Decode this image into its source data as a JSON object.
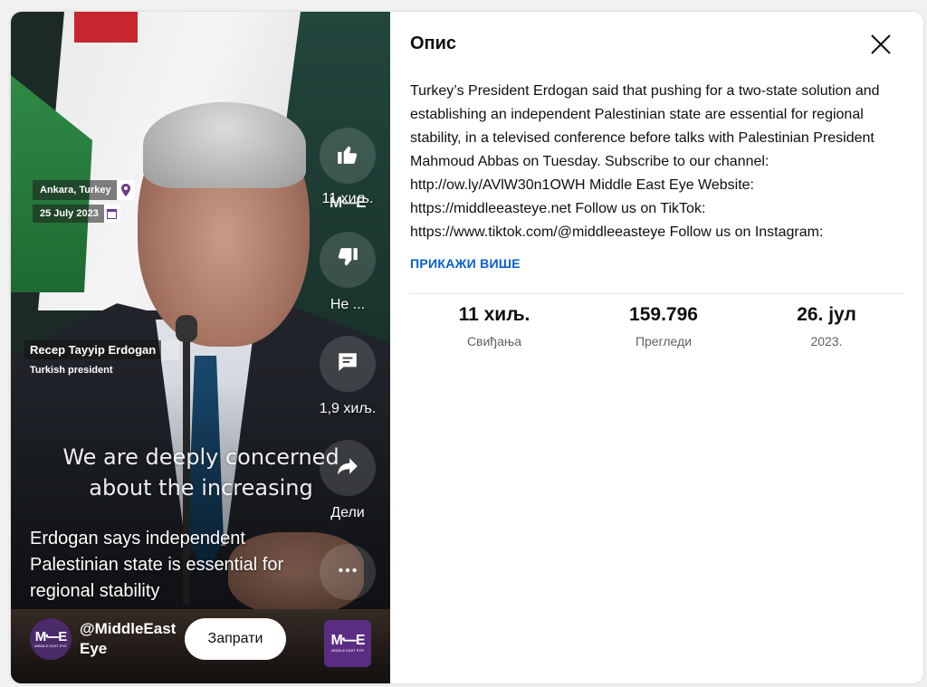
{
  "video": {
    "location": "Ankara, Turkey",
    "date": "25 July 2023",
    "speaker_name": "Recep Tayyip Erdogan",
    "speaker_role": "Turkish president",
    "caption": "We are deeply concerned about the increasing",
    "title": "Erdogan says independent Palestinian state is essential for regional stability",
    "channel_handle": "@MiddleEast Eye",
    "subscribe_label": "Запрати",
    "logo_text": "M⹃E",
    "logo_sub": "MIDDLE EAST EYE",
    "like_count": "11 хиљ.",
    "dislike_label": "Не ...",
    "comment_count": "1,9 хиљ.",
    "share_label": "Дели"
  },
  "panel": {
    "title": "Опис",
    "description": "Turkey’s President Erdogan said that pushing for a two-state solution and establishing an independent Palestinian state are essential for regional stability, in a televised conference before talks with Palestinian President Mahmoud Abbas on Tuesday. Subscribe to our channel: http://ow.ly/AVlW30n1OWH Middle East Eye Website: https://middleeasteye.net Follow us on TikTok: https://www.tiktok.com/@middleeasteye Follow us on Instagram:",
    "show_more": "ПРИКАЖИ ВИШЕ",
    "stats": [
      {
        "value": "11 хиљ.",
        "label": "Свиђања"
      },
      {
        "value": "159.796",
        "label": "Прегледи"
      },
      {
        "value": "26. јул",
        "label": "2023."
      }
    ]
  },
  "colors": {
    "accent_link": "#065fd4",
    "brand_purple": "#5a2d82"
  }
}
